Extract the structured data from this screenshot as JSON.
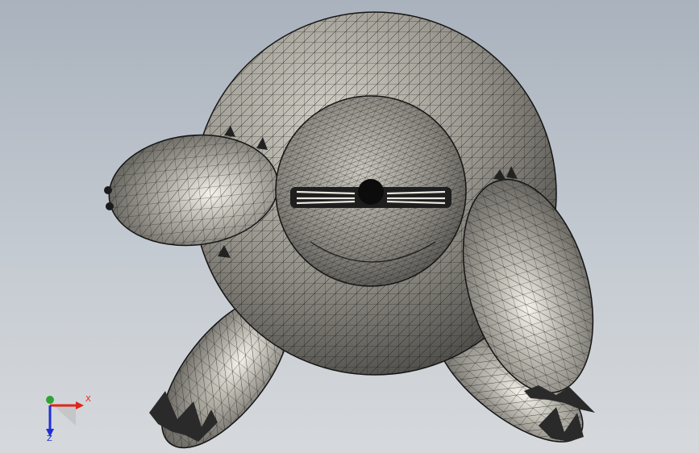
{
  "viewport": {
    "background_top": "#a9b2bd",
    "background_bottom": "#d6d9dc",
    "surface_color": "#8e8c85",
    "mesh_color": "#1b1b1b"
  },
  "triad": {
    "x_label": "X",
    "z_label": "Z",
    "x_color": "#e0261b",
    "y_color": "#2fa436",
    "z_color": "#1e2fd6"
  }
}
